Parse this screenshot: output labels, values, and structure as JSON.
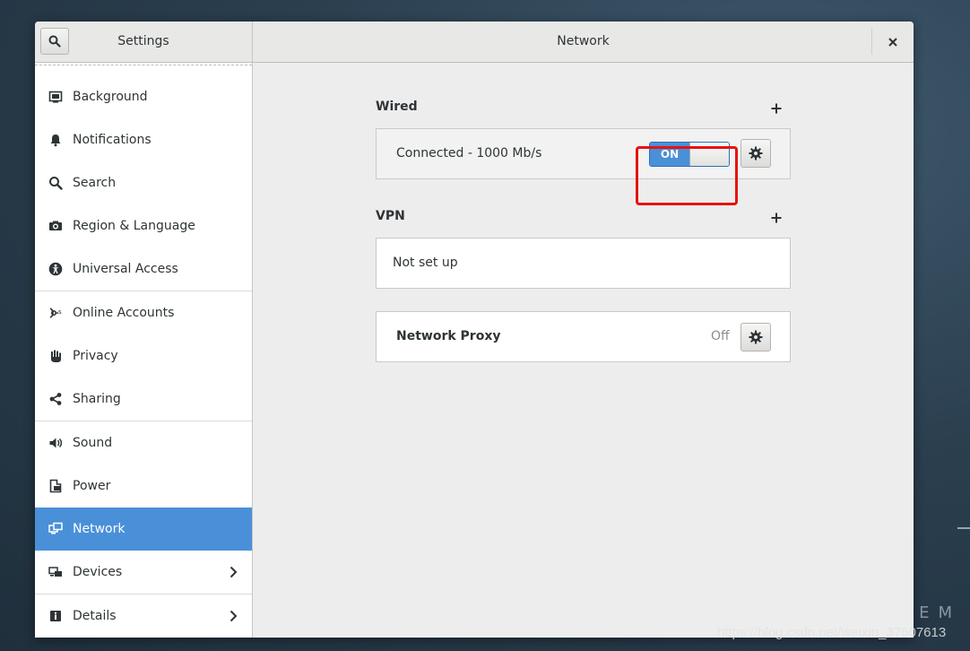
{
  "window": {
    "sidebar_title": "Settings",
    "page_title": "Network"
  },
  "sidebar": {
    "items": [
      {
        "label": "Background",
        "icon": "background-icon"
      },
      {
        "label": "Notifications",
        "icon": "bell-icon"
      },
      {
        "label": "Search",
        "icon": "search-icon"
      },
      {
        "label": "Region & Language",
        "icon": "camera-icon"
      },
      {
        "label": "Universal Access",
        "icon": "accessibility-icon"
      },
      {
        "label": "Online Accounts",
        "icon": "online-accounts-icon"
      },
      {
        "label": "Privacy",
        "icon": "hand-icon"
      },
      {
        "label": "Sharing",
        "icon": "share-icon"
      },
      {
        "label": "Sound",
        "icon": "speaker-icon"
      },
      {
        "label": "Power",
        "icon": "power-icon"
      },
      {
        "label": "Network",
        "icon": "network-icon",
        "selected": true
      },
      {
        "label": "Devices",
        "icon": "devices-icon",
        "has_submenu": true
      },
      {
        "label": "Details",
        "icon": "info-icon",
        "has_submenu": true
      }
    ]
  },
  "wired": {
    "section_label": "Wired",
    "status": "Connected - 1000 Mb/s",
    "toggle_label": "ON"
  },
  "vpn": {
    "section_label": "VPN",
    "status": "Not set up"
  },
  "proxy": {
    "label": "Network Proxy",
    "status": "Off"
  },
  "background": {
    "watermark": "https://blog.csdn.net/weixin_37607613",
    "partial_text": "CEM"
  },
  "colors": {
    "accent": "#4a90d9",
    "highlight": "#e8120f"
  }
}
